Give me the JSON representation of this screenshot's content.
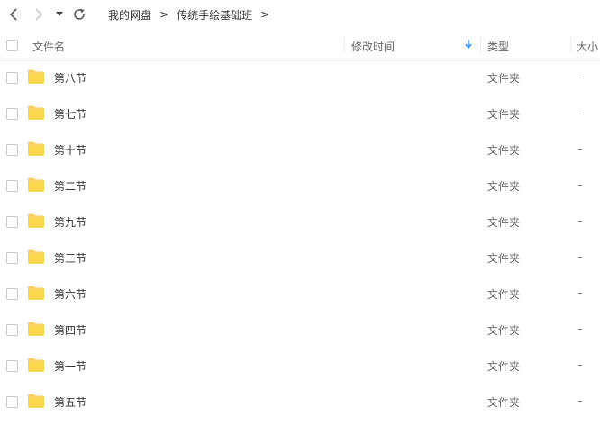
{
  "toolbar": {
    "icons": [
      "back-icon",
      "forward-icon",
      "dropdown-icon",
      "refresh-icon"
    ]
  },
  "breadcrumb": {
    "root": "我的网盘",
    "separator": ">",
    "current": "传统手绘基础班",
    "trailing": ">"
  },
  "columns": {
    "name": "文件名",
    "modified": "修改时间",
    "type": "类型",
    "size": "大小"
  },
  "sort_icon": "sort-down-arrow-icon",
  "accent_color": "#2d8cf0",
  "folder_color": "#f8d25c",
  "rows": [
    {
      "name": "第八节",
      "type": "文件夹",
      "size": "-"
    },
    {
      "name": "第七节",
      "type": "文件夹",
      "size": "-"
    },
    {
      "name": "第十节",
      "type": "文件夹",
      "size": "-"
    },
    {
      "name": "第二节",
      "type": "文件夹",
      "size": "-"
    },
    {
      "name": "第九节",
      "type": "文件夹",
      "size": "-"
    },
    {
      "name": "第三节",
      "type": "文件夹",
      "size": "-"
    },
    {
      "name": "第六节",
      "type": "文件夹",
      "size": "-"
    },
    {
      "name": "第四节",
      "type": "文件夹",
      "size": "-"
    },
    {
      "name": "第一节",
      "type": "文件夹",
      "size": "-"
    },
    {
      "name": "第五节",
      "type": "文件夹",
      "size": "-"
    }
  ]
}
